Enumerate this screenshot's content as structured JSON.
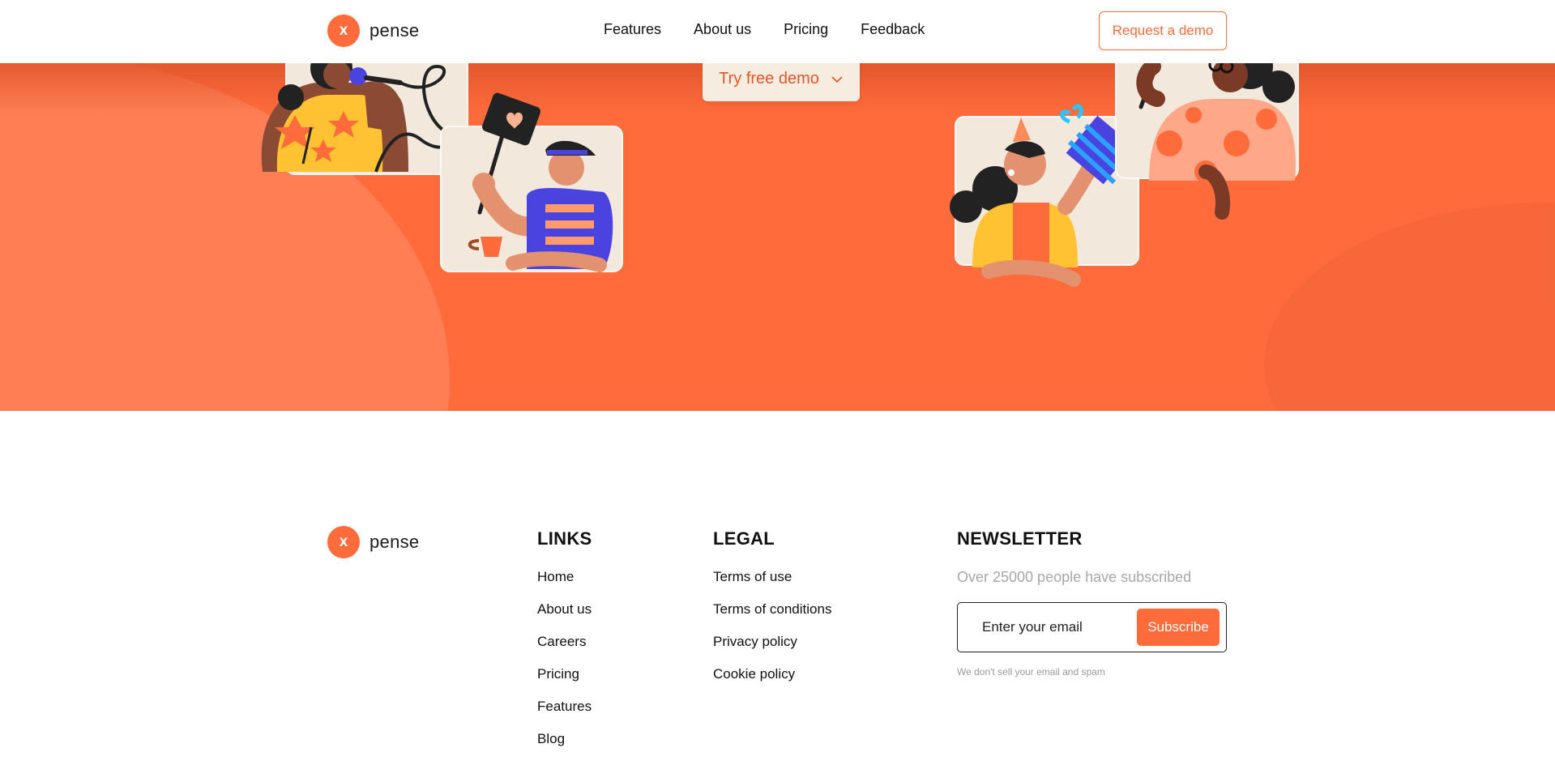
{
  "brand": {
    "logo_letter": "x",
    "name": "pense",
    "color": "#ff6b3b"
  },
  "nav": {
    "links": [
      "Features",
      "About us",
      "Pricing",
      "Feedback"
    ],
    "cta": "Request a demo"
  },
  "hero": {
    "demo_button": "Try free demo",
    "background": "#ff6b3b",
    "illustrations": [
      "singer-card",
      "heart-sign-card",
      "party-gift-card",
      "polka-dot-card"
    ]
  },
  "footer": {
    "links": {
      "heading": "LINKS",
      "items": [
        "Home",
        "About us",
        "Careers",
        "Pricing",
        "Features",
        "Blog"
      ]
    },
    "legal": {
      "heading": "LEGAL",
      "items": [
        "Terms of use",
        "Terms of conditions",
        "Privacy policy",
        "Cookie policy"
      ]
    },
    "newsletter": {
      "heading": "NEWSLETTER",
      "subtext": "Over 25000 people have subscribed",
      "placeholder": "Enter your email",
      "button": "Subscribe",
      "note": "We don't sell your email and spam"
    }
  },
  "icons": {
    "dropdown": "chevron-down-icon"
  }
}
